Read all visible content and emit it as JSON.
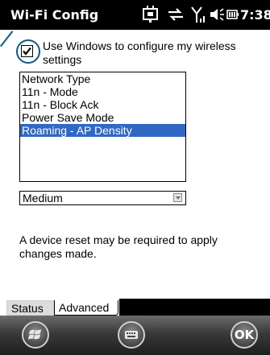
{
  "titlebar": {
    "title": "Wi-Fi Config",
    "clock": "7:38",
    "icons": [
      "connectivity-icon",
      "sync-icon",
      "signal-icon",
      "volume-icon",
      "battery-icon"
    ]
  },
  "config": {
    "use_windows_label": "Use Windows to configure my wireless settings",
    "use_windows_checked": true
  },
  "settings_list": {
    "items": [
      "Network Type",
      "11n - Mode",
      "11n - Block Ack",
      "Power Save Mode",
      "Roaming - AP Density"
    ],
    "selected_index": 4
  },
  "value_dropdown": {
    "value": "Medium"
  },
  "note": "A device reset may be required to apply changes made.",
  "tabs": [
    {
      "label": "Status",
      "active": false
    },
    {
      "label": "Advanced",
      "active": true
    }
  ],
  "softbar": {
    "ok_label": "OK"
  },
  "colors": {
    "selection": "#3168c6",
    "callout": "#0e5a86"
  }
}
